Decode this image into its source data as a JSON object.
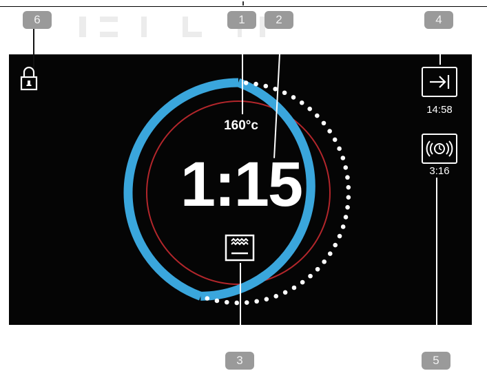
{
  "callouts": {
    "c1": "1",
    "c2": "2",
    "c3": "3",
    "c4": "4",
    "c5": "5",
    "c6": "6"
  },
  "display": {
    "temperature": "160°c",
    "time": "1:15",
    "end_time": "14:58",
    "timer": "3:16"
  },
  "icons": {
    "lock": "lock-icon",
    "end_time": "arrow-to-end-icon",
    "timer": "alarm-icon",
    "oven_mode": "oven-heat-mode-icon"
  },
  "colors": {
    "background": "#050505",
    "progress_ring": "#3aa6dc",
    "inner_ring": "#b3262b",
    "text": "#ffffff",
    "callout": "#9a9a9a"
  }
}
